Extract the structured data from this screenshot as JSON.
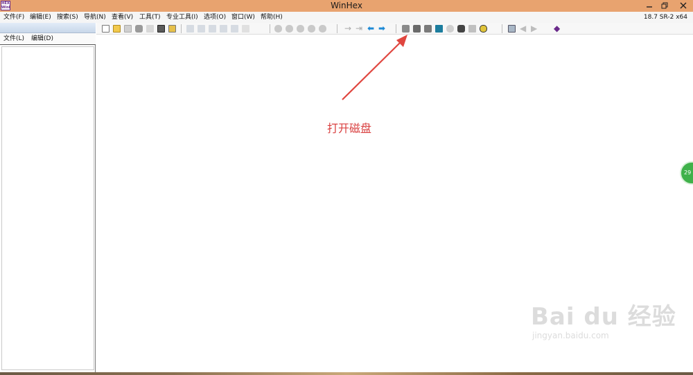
{
  "window": {
    "title": "WinHex",
    "version": "18.7 SR-2 x64",
    "app_icon_text": [
      "HEX",
      "WinHex"
    ]
  },
  "menu": [
    "文件(F)",
    "编辑(E)",
    "搜索(S)",
    "导航(N)",
    "查看(V)",
    "工具(T)",
    "专业工具(I)",
    "选项(O)",
    "窗口(W)",
    "帮助(H)"
  ],
  "left_panel": {
    "menu": [
      "文件(L)",
      "编辑(D)"
    ]
  },
  "toolbar": {
    "icons": [
      "new-file-icon",
      "open-file-icon",
      "save-icon",
      "print-icon",
      "properties-icon",
      "clipboard-icon",
      "export-icon",
      "undo-icon",
      "copy-icon",
      "cut-icon",
      "paste-icon",
      "paste-special-icon",
      "hex-icon",
      "find-icon",
      "find-hex-icon",
      "replace-icon",
      "replace-hex-icon",
      "cross-icon",
      "goto-offset-icon",
      "goto-end-icon",
      "back-icon",
      "forward-icon",
      "open-disk-icon",
      "open-drive-icon",
      "open-media-icon",
      "ram-icon",
      "search-disk-icon",
      "analyze-icon",
      "chart-icon",
      "tools-icon",
      "grid-icon",
      "prev-icon",
      "next-icon",
      "winhex-logo-icon"
    ]
  },
  "annotation": {
    "label": "打开磁盘"
  },
  "badge": {
    "text": "29"
  },
  "watermark": {
    "brand": "Bai du 经验",
    "url": "jingyan.baidu.com"
  },
  "colors": {
    "titlebar": "#e8a36f",
    "annotation": "#d94040",
    "badge": "#3fb14a"
  }
}
